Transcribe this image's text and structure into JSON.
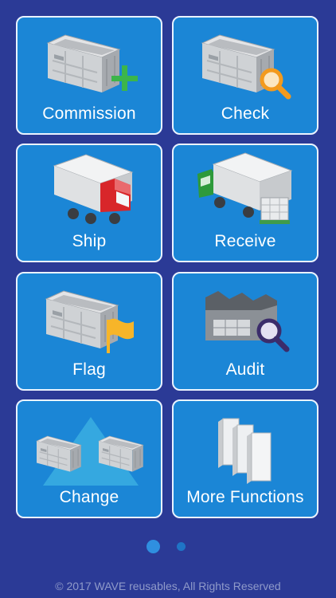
{
  "tiles": [
    {
      "label": "Commission",
      "icon": "crate-plus-icon"
    },
    {
      "label": "Check",
      "icon": "crate-magnifier-icon"
    },
    {
      "label": "Ship",
      "icon": "truck-icon"
    },
    {
      "label": "Receive",
      "icon": "truck-pallet-icon"
    },
    {
      "label": "Flag",
      "icon": "crate-flag-icon"
    },
    {
      "label": "Audit",
      "icon": "warehouse-magnifier-icon"
    },
    {
      "label": "Change",
      "icon": "crates-triangle-icon"
    },
    {
      "label": "More Functions",
      "icon": "panels-stack-icon"
    }
  ],
  "pagination": {
    "pages": 2,
    "active": 1
  },
  "footer": {
    "text": "© 2017 WAVE reusables, All Rights Reserved"
  },
  "colors": {
    "background": "#2b3a96",
    "tile": "#1b86d6",
    "tile_border": "#eaf3ff",
    "plus": "#3cb54a",
    "magnifier_orange": "#f39a1e",
    "truck_red": "#d8262a",
    "truck_green": "#2e9a3b",
    "flag": "#f7b529",
    "magnifier_purple": "#3b2c6b"
  }
}
